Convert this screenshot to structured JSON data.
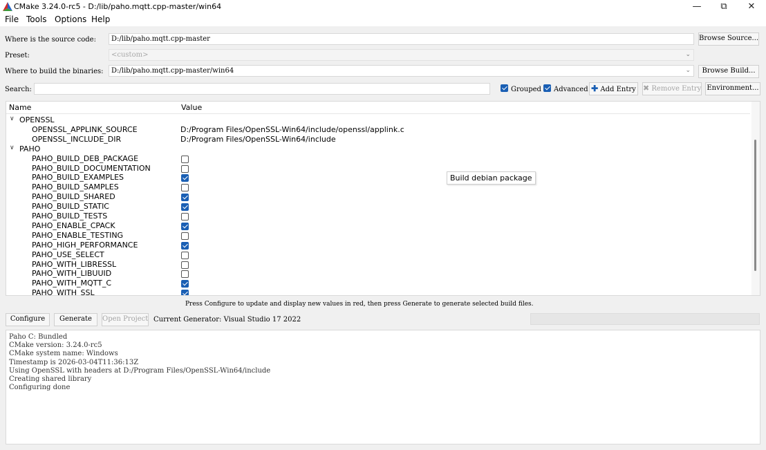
{
  "window": {
    "title": "CMake 3.24.0-rc5 - D:/lib/paho.mqtt.cpp-master/win64",
    "minimize_glyph": "—",
    "maximize_glyph": "⧉",
    "close_glyph": "✕"
  },
  "menu": [
    "File",
    "Tools",
    "Options",
    "Help"
  ],
  "source": {
    "label": "Where is the source code:",
    "value": "D:/lib/paho.mqtt.cpp-master",
    "browse": "Browse Source..."
  },
  "preset": {
    "label": "Preset:",
    "value": "<custom>"
  },
  "build": {
    "label": "Where to build the binaries:",
    "value": "D:/lib/paho.mqtt.cpp-master/win64",
    "browse": "Browse Build..."
  },
  "search": {
    "label": "Search:",
    "value": ""
  },
  "toolbar": {
    "grouped": {
      "label": "Grouped",
      "checked": true
    },
    "advanced": {
      "label": "Advanced",
      "checked": true
    },
    "add_entry": "Add Entry",
    "remove_entry": "Remove Entry",
    "environment": "Environment..."
  },
  "tree": {
    "col_name": "Name",
    "col_value": "Value",
    "groups": [
      {
        "name": "OPENSSL",
        "entries": [
          {
            "name": "OPENSSL_APPLINK_SOURCE",
            "value": "D:/Program Files/OpenSSL-Win64/include/openssl/applink.c"
          },
          {
            "name": "OPENSSL_INCLUDE_DIR",
            "value": "D:/Program Files/OpenSSL-Win64/include"
          }
        ]
      },
      {
        "name": "PAHO",
        "entries": [
          {
            "name": "PAHO_BUILD_DEB_PACKAGE",
            "checked": false
          },
          {
            "name": "PAHO_BUILD_DOCUMENTATION",
            "checked": false
          },
          {
            "name": "PAHO_BUILD_EXAMPLES",
            "checked": true
          },
          {
            "name": "PAHO_BUILD_SAMPLES",
            "checked": false
          },
          {
            "name": "PAHO_BUILD_SHARED",
            "checked": true
          },
          {
            "name": "PAHO_BUILD_STATIC",
            "checked": true
          },
          {
            "name": "PAHO_BUILD_TESTS",
            "checked": false
          },
          {
            "name": "PAHO_ENABLE_CPACK",
            "checked": true
          },
          {
            "name": "PAHO_ENABLE_TESTING",
            "checked": false
          },
          {
            "name": "PAHO_HIGH_PERFORMANCE",
            "checked": true
          },
          {
            "name": "PAHO_USE_SELECT",
            "checked": false
          },
          {
            "name": "PAHO_WITH_LIBRESSL",
            "checked": false
          },
          {
            "name": "PAHO_WITH_LIBUUID",
            "checked": false
          },
          {
            "name": "PAHO_WITH_MQTT_C",
            "checked": true
          },
          {
            "name": "PAHO_WITH_SSL",
            "checked": true
          }
        ]
      }
    ],
    "tooltip": "Build debian package"
  },
  "hint": "Press Configure to update and display new values in red, then press Generate to generate selected build files.",
  "actions": {
    "configure": "Configure",
    "generate": "Generate",
    "open_project": "Open Project",
    "generator": "Current Generator: Visual Studio 17 2022"
  },
  "output": [
    "Paho C: Bundled",
    "CMake version: 3.24.0-rc5",
    "CMake system name: Windows",
    "Timestamp is 2026-03-04T11:36:13Z",
    "Using OpenSSL with headers at D:/Program Files/OpenSSL-Win64/include",
    "Creating shared library",
    "Configuring done"
  ],
  "colors": {
    "accent": "#1a5fb4",
    "cmake_red": "#d42a2a",
    "cmake_green": "#3a9a3a",
    "cmake_blue": "#2563c9"
  }
}
